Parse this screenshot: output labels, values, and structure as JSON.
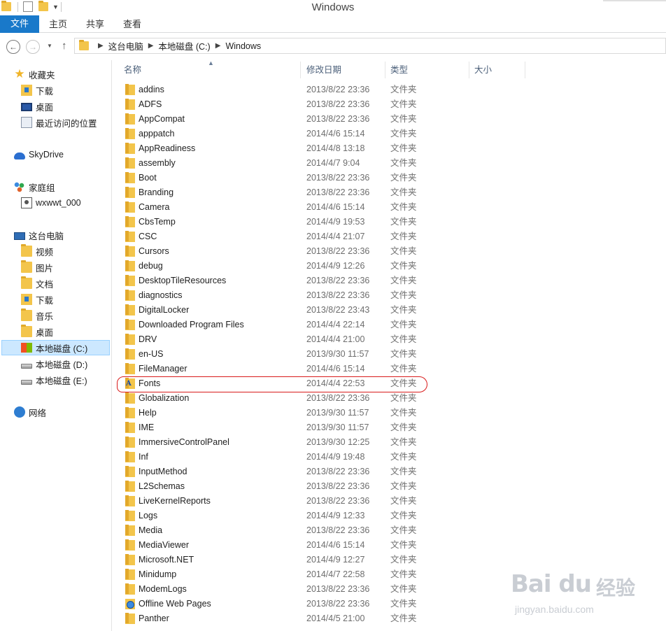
{
  "window": {
    "title": "Windows"
  },
  "ribbon": {
    "tabs": [
      "文件",
      "主页",
      "共享",
      "查看"
    ]
  },
  "address": {
    "crumbs": [
      "这台电脑",
      "本地磁盘 (C:)",
      "Windows"
    ]
  },
  "sidebar": {
    "favorites_label": "收藏夹",
    "favorites": [
      "下载",
      "桌面",
      "最近访问的位置"
    ],
    "skydrive_label": "SkyDrive",
    "homegroup_label": "家庭组",
    "homegroup_user": "wxwwt_000",
    "thispc_label": "这台电脑",
    "thispc": [
      "视频",
      "图片",
      "文档",
      "下载",
      "音乐",
      "桌面"
    ],
    "drives": [
      "本地磁盘 (C:)",
      "本地磁盘 (D:)",
      "本地磁盘 (E:)"
    ],
    "network_label": "网络"
  },
  "columns": {
    "name": "名称",
    "modified": "修改日期",
    "type": "类型",
    "size": "大小"
  },
  "files": [
    {
      "name": "addins",
      "date": "2013/8/22 23:36",
      "type": "文件夹",
      "icon": "folder-icon"
    },
    {
      "name": "ADFS",
      "date": "2013/8/22 23:36",
      "type": "文件夹",
      "icon": "folder-icon"
    },
    {
      "name": "AppCompat",
      "date": "2013/8/22 23:36",
      "type": "文件夹",
      "icon": "folder-icon"
    },
    {
      "name": "apppatch",
      "date": "2014/4/6 15:14",
      "type": "文件夹",
      "icon": "folder-icon"
    },
    {
      "name": "AppReadiness",
      "date": "2014/4/8 13:18",
      "type": "文件夹",
      "icon": "folder-icon"
    },
    {
      "name": "assembly",
      "date": "2014/4/7 9:04",
      "type": "文件夹",
      "icon": "folder-icon"
    },
    {
      "name": "Boot",
      "date": "2013/8/22 23:36",
      "type": "文件夹",
      "icon": "folder-icon"
    },
    {
      "name": "Branding",
      "date": "2013/8/22 23:36",
      "type": "文件夹",
      "icon": "folder-icon"
    },
    {
      "name": "Camera",
      "date": "2014/4/6 15:14",
      "type": "文件夹",
      "icon": "folder-icon"
    },
    {
      "name": "CbsTemp",
      "date": "2014/4/9 19:53",
      "type": "文件夹",
      "icon": "folder-icon"
    },
    {
      "name": "CSC",
      "date": "2014/4/4 21:07",
      "type": "文件夹",
      "icon": "folder-icon"
    },
    {
      "name": "Cursors",
      "date": "2013/8/22 23:36",
      "type": "文件夹",
      "icon": "folder-icon"
    },
    {
      "name": "debug",
      "date": "2014/4/9 12:26",
      "type": "文件夹",
      "icon": "folder-icon"
    },
    {
      "name": "DesktopTileResources",
      "date": "2013/8/22 23:36",
      "type": "文件夹",
      "icon": "folder-icon"
    },
    {
      "name": "diagnostics",
      "date": "2013/8/22 23:36",
      "type": "文件夹",
      "icon": "folder-icon"
    },
    {
      "name": "DigitalLocker",
      "date": "2013/8/22 23:43",
      "type": "文件夹",
      "icon": "folder-icon"
    },
    {
      "name": "Downloaded Program Files",
      "date": "2014/4/4 22:14",
      "type": "文件夹",
      "icon": "folder-icon"
    },
    {
      "name": "DRV",
      "date": "2014/4/4 21:00",
      "type": "文件夹",
      "icon": "folder-icon"
    },
    {
      "name": "en-US",
      "date": "2013/9/30 11:57",
      "type": "文件夹",
      "icon": "folder-icon"
    },
    {
      "name": "FileManager",
      "date": "2014/4/6 15:14",
      "type": "文件夹",
      "icon": "folder-icon"
    },
    {
      "name": "Fonts",
      "date": "2014/4/4 22:53",
      "type": "文件夹",
      "icon": "fonts-folder-icon"
    },
    {
      "name": "Globalization",
      "date": "2013/8/22 23:36",
      "type": "文件夹",
      "icon": "folder-icon"
    },
    {
      "name": "Help",
      "date": "2013/9/30 11:57",
      "type": "文件夹",
      "icon": "folder-icon"
    },
    {
      "name": "IME",
      "date": "2013/9/30 11:57",
      "type": "文件夹",
      "icon": "folder-icon"
    },
    {
      "name": "ImmersiveControlPanel",
      "date": "2013/9/30 12:25",
      "type": "文件夹",
      "icon": "folder-icon"
    },
    {
      "name": "Inf",
      "date": "2014/4/9 19:48",
      "type": "文件夹",
      "icon": "folder-icon"
    },
    {
      "name": "InputMethod",
      "date": "2013/8/22 23:36",
      "type": "文件夹",
      "icon": "folder-icon"
    },
    {
      "name": "L2Schemas",
      "date": "2013/8/22 23:36",
      "type": "文件夹",
      "icon": "folder-icon"
    },
    {
      "name": "LiveKernelReports",
      "date": "2013/8/22 23:36",
      "type": "文件夹",
      "icon": "folder-icon"
    },
    {
      "name": "Logs",
      "date": "2014/4/9 12:33",
      "type": "文件夹",
      "icon": "folder-icon"
    },
    {
      "name": "Media",
      "date": "2013/8/22 23:36",
      "type": "文件夹",
      "icon": "folder-icon"
    },
    {
      "name": "MediaViewer",
      "date": "2014/4/6 15:14",
      "type": "文件夹",
      "icon": "folder-icon"
    },
    {
      "name": "Microsoft.NET",
      "date": "2014/4/9 12:27",
      "type": "文件夹",
      "icon": "folder-icon"
    },
    {
      "name": "Minidump",
      "date": "2014/4/7 22:58",
      "type": "文件夹",
      "icon": "folder-icon"
    },
    {
      "name": "ModemLogs",
      "date": "2013/8/22 23:36",
      "type": "文件夹",
      "icon": "folder-icon"
    },
    {
      "name": "Offline Web Pages",
      "date": "2013/8/22 23:36",
      "type": "文件夹",
      "icon": "web-folder-icon"
    },
    {
      "name": "Panther",
      "date": "2014/4/5 21:00",
      "type": "文件夹",
      "icon": "folder-icon"
    }
  ],
  "watermark": {
    "logo": "Bai du",
    "cn": "经验",
    "site": "jingyan.baidu.com"
  },
  "colors": {
    "file_tab": "#1979ca",
    "selection": "#cce8ff",
    "annotation": "#d91b1b"
  }
}
